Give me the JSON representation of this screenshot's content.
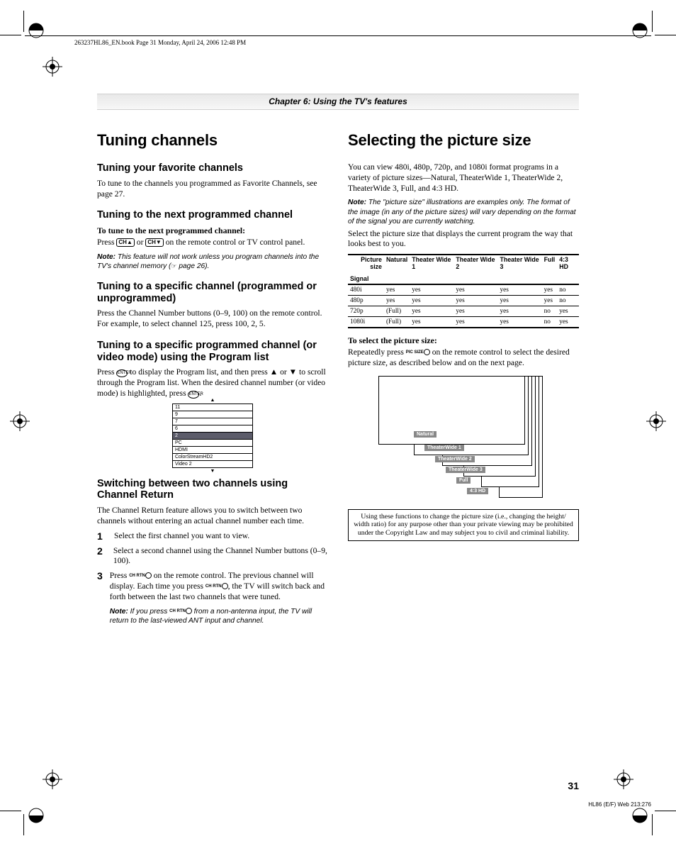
{
  "header_line": "263237HL86_EN.book  Page 31  Monday, April 24, 2006  12:48 PM",
  "chapter_band": "Chapter 6: Using the TV's features",
  "left": {
    "h1": "Tuning channels",
    "fav_h": "Tuning your favorite channels",
    "fav_p": "To tune to the channels you programmed as Favorite Channels, see page 27.",
    "next_h": "Tuning to the next programmed channel",
    "next_strong": "To tune to the next programmed channel:",
    "next_p_pre": "Press ",
    "next_p_post": " on the remote control or TV control panel.",
    "next_or": " or ",
    "next_note_pre": "This feature will not work unless you program channels into the TV's channel memory (",
    "next_note_post": " page 26).",
    "spec_h": "Tuning to a specific channel (programmed or unprogrammed)",
    "spec_p": "Press the Channel Number buttons (0–9, 100) on the remote control. For example, to select channel 125, press 100, 2, 5.",
    "proglist_h": "Tuning to a specific programmed channel (or video mode) using the Program list",
    "proglist_p1_pre": "Press ",
    "proglist_p1_mid": " to display the Program list, and then press ",
    "proglist_p1_or": " or ",
    "proglist_p1_post": " to scroll through the Program list. When the desired channel number (or video mode) is highlighted, press ",
    "proglist_p1_end": ".",
    "prog_items": [
      "11",
      "9",
      "7",
      "6",
      "2",
      "PC",
      "HDMI",
      "ColorStreamHD2",
      "Video 2"
    ],
    "prog_selected_index": 4,
    "chret_h": "Switching between two channels using Channel Return",
    "chret_p": "The Channel Return feature allows you to switch between two channels without entering an actual channel number each time.",
    "steps": [
      "Select the first channel you want to view.",
      "Select a second channel using the Channel Number buttons (0–9, 100).",
      ""
    ],
    "step3_pre": "Press ",
    "step3_mid": " on the remote control. The previous channel will display. Each time you press ",
    "step3_post": ", the TV will switch back and forth between the last two channels that were tuned.",
    "step3_note_pre": "If you press ",
    "step3_note_post": " from a non-antenna input, the TV will return to the last-viewed ANT input and channel.",
    "icon_ch_up": "CH▲",
    "icon_ch_dn": "CH▼",
    "icon_enter": "ENTER",
    "icon_up": "▲",
    "icon_dn": "▼",
    "icon_chrtn": "CH RTN",
    "icon_pointer": "☞"
  },
  "right": {
    "h1": "Selecting the picture size",
    "intro": "You can view 480i, 480p, 720p, and 1080i format programs in a variety of picture sizes—Natural, TheaterWide 1, TheaterWide 2, TheaterWide 3, Full, and 4:3 HD.",
    "note1": "The \"picture size\" illustrations are examples only. The format of the image (in any of the picture sizes) will vary depending on the format of the signal you are currently watching.",
    "select_p": "Select the picture size that displays the current program the way that looks best to you.",
    "table": {
      "corner_top": "Picture size",
      "corner_bottom": "Signal",
      "cols": [
        "Natural",
        "Theater Wide 1",
        "Theater Wide 2",
        "Theater Wide 3",
        "Full",
        "4:3 HD"
      ],
      "rows": [
        {
          "sig": "480i",
          "cells": [
            "yes",
            "yes",
            "yes",
            "yes",
            "yes",
            "no"
          ]
        },
        {
          "sig": "480p",
          "cells": [
            "yes",
            "yes",
            "yes",
            "yes",
            "yes",
            "no"
          ]
        },
        {
          "sig": "720p",
          "cells": [
            "(Full)",
            "yes",
            "yes",
            "yes",
            "no",
            "yes"
          ]
        },
        {
          "sig": "1080i",
          "cells": [
            "(Full)",
            "yes",
            "yes",
            "yes",
            "no",
            "yes"
          ]
        }
      ]
    },
    "tosel_strong": "To select the picture size:",
    "tosel_pre": "Repeatedly press ",
    "tosel_post": " on the remote control to select the desired picture size, as described below and on the next page.",
    "icon_picsize": "PIC SIZE",
    "tags": [
      "Natural",
      "TheaterWide 1",
      "TheaterWide 2",
      "TheaterWide 3",
      "Full",
      "4:3 HD"
    ],
    "disclaimer": "Using these functions to change the picture size (i.e., changing the height/ width ratio) for any purpose other than your private viewing may be prohibited under the Copyright Law and may subject you to civil and criminal liability."
  },
  "page_num": "31",
  "footer_code": "HL86 (E/F) Web 213:276",
  "note_label": "Note:"
}
